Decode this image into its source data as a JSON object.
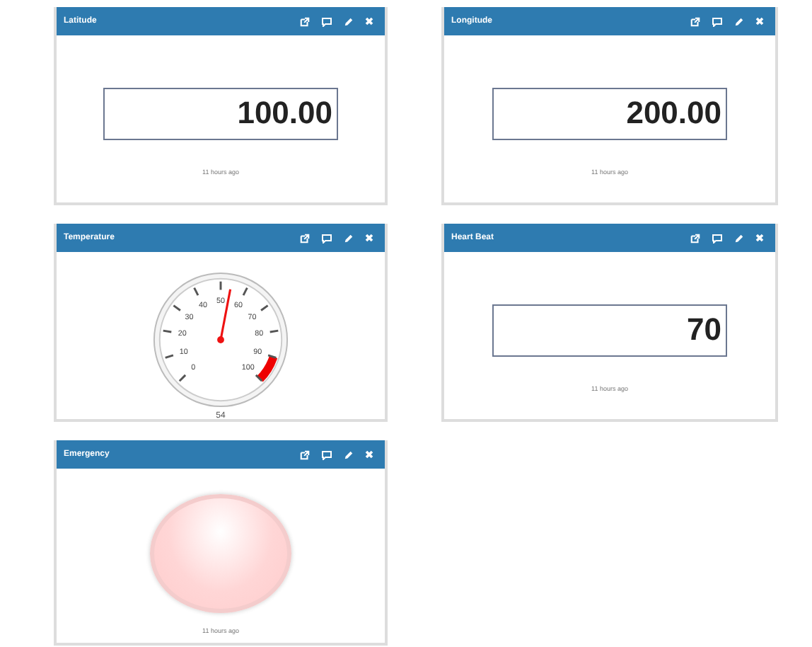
{
  "tiles": [
    {
      "kind": "text",
      "title": "Latitude",
      "value": "100.00",
      "time": "11 hours ago"
    },
    {
      "kind": "text",
      "title": "Longitude",
      "value": "200.00",
      "time": "11 hours ago"
    },
    {
      "kind": "gauge",
      "title": "Temperature",
      "value": "54",
      "scale": [
        "0",
        "10",
        "20",
        "30",
        "40",
        "50",
        "60",
        "70",
        "80",
        "90",
        "100"
      ]
    },
    {
      "kind": "text",
      "title": "Heart Beat",
      "value": "70",
      "time": "11 hours ago"
    },
    {
      "kind": "led",
      "title": "Emergency",
      "on": false,
      "time": "11 hours ago"
    }
  ]
}
